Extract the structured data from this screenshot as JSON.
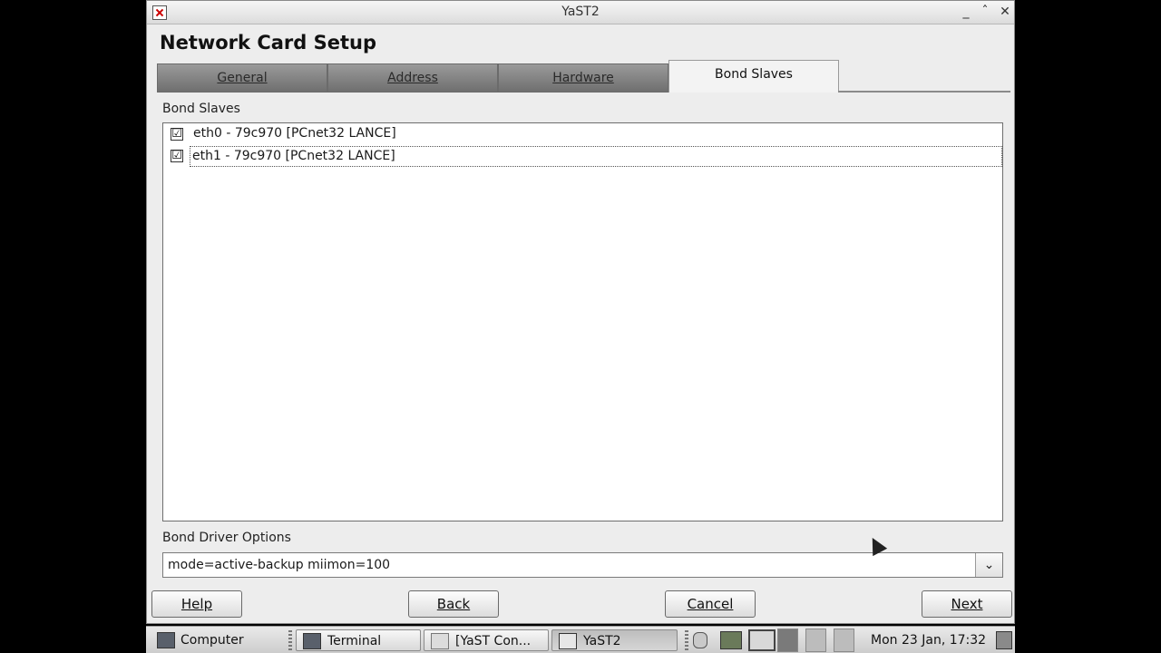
{
  "window": {
    "title": "YaST2",
    "controls": [
      "_",
      "ˆ",
      "✕"
    ]
  },
  "heading": "Network Card Setup",
  "tabs": [
    {
      "label": "General"
    },
    {
      "label": "Address"
    },
    {
      "label": "Hardware"
    },
    {
      "label": "Bond Slaves",
      "active": true
    }
  ],
  "bond_slaves": {
    "label": "Bond Slaves",
    "items": [
      {
        "checked": true,
        "check_glyph": "☑",
        "text": "eth0 - 79c970 [PCnet32 LANCE]"
      },
      {
        "checked": true,
        "check_glyph": "☑",
        "text": "eth1 - 79c970 [PCnet32 LANCE]"
      }
    ]
  },
  "bond_driver_options": {
    "label": "Bond Driver Options",
    "value": "mode=active-backup miimon=100"
  },
  "buttons": {
    "help": "Help",
    "back": "Back",
    "cancel": "Cancel",
    "next": "Next"
  },
  "taskbar": {
    "computer": "Computer",
    "tasks": [
      {
        "label": "Terminal",
        "icon": "terminal-icon"
      },
      {
        "label": "[YaST Con...",
        "icon": "yast-control-icon"
      },
      {
        "label": "YaST2",
        "icon": "yast2-icon",
        "active": true
      }
    ],
    "clock": "Mon 23 Jan, 17:32"
  }
}
